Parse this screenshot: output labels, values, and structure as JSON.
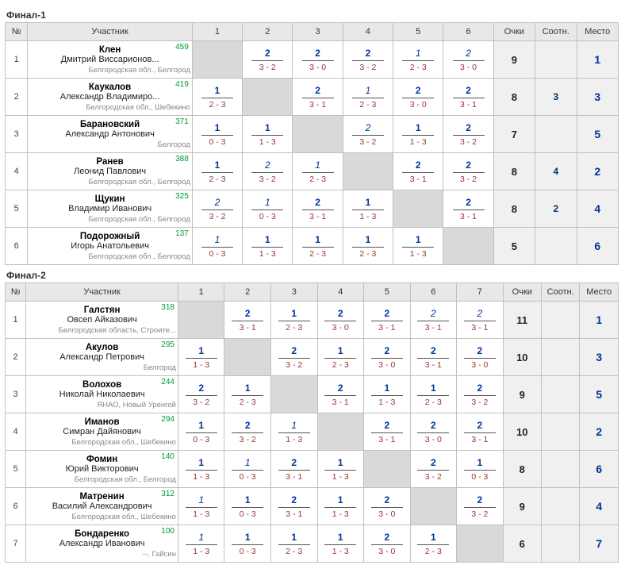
{
  "headers": {
    "num": "№",
    "participant": "Участник",
    "points": "Очки",
    "ratio": "Соотн.",
    "place": "Место"
  },
  "groups": [
    {
      "title": "Финал-1",
      "size": 6,
      "players": [
        {
          "num": 1,
          "last": "Клен",
          "first": "Дмитрий Виссарионов...",
          "rating": "459",
          "loc": "Белгородская обл., Белгород",
          "results": [
            null,
            {
              "t": "2",
              "b": "3 - 2"
            },
            {
              "t": "2",
              "b": "3 - 0"
            },
            {
              "t": "2",
              "b": "3 - 2"
            },
            {
              "t": "1",
              "i": true,
              "b": "2 - 3"
            },
            {
              "t": "2",
              "i": true,
              "b": "3 - 0"
            }
          ],
          "points": "9",
          "ratio": "",
          "place": "1"
        },
        {
          "num": 2,
          "last": "Каукалов",
          "first": "Александр Владимиро...",
          "rating": "419",
          "loc": "Белгородская обл., Шебекино",
          "results": [
            {
              "t": "1",
              "b": "2 - 3"
            },
            null,
            {
              "t": "2",
              "b": "3 - 1"
            },
            {
              "t": "1",
              "i": true,
              "b": "2 - 3"
            },
            {
              "t": "2",
              "b": "3 - 0"
            },
            {
              "t": "2",
              "b": "3 - 1"
            }
          ],
          "points": "8",
          "ratio": "3",
          "place": "3"
        },
        {
          "num": 3,
          "last": "Барановский",
          "first": "Александр Антонович",
          "rating": "371",
          "loc": "Белгород",
          "results": [
            {
              "t": "1",
              "b": "0 - 3"
            },
            {
              "t": "1",
              "b": "1 - 3"
            },
            null,
            {
              "t": "2",
              "i": true,
              "b": "3 - 2"
            },
            {
              "t": "1",
              "b": "1 - 3"
            },
            {
              "t": "2",
              "b": "3 - 2"
            }
          ],
          "points": "7",
          "ratio": "",
          "place": "5"
        },
        {
          "num": 4,
          "last": "Ранев",
          "first": "Леонид Павлович",
          "rating": "388",
          "loc": "Белгородская обл., Белгород",
          "results": [
            {
              "t": "1",
              "b": "2 - 3"
            },
            {
              "t": "2",
              "i": true,
              "b": "3 - 2"
            },
            {
              "t": "1",
              "i": true,
              "b": "2 - 3"
            },
            null,
            {
              "t": "2",
              "b": "3 - 1"
            },
            {
              "t": "2",
              "b": "3 - 2"
            }
          ],
          "points": "8",
          "ratio": "4",
          "place": "2"
        },
        {
          "num": 5,
          "last": "Щукин",
          "first": "Владимир Иванович",
          "rating": "325",
          "loc": "Белгородская обл., Белгород",
          "results": [
            {
              "t": "2",
              "i": true,
              "b": "3 - 2"
            },
            {
              "t": "1",
              "i": true,
              "b": "0 - 3"
            },
            {
              "t": "2",
              "b": "3 - 1"
            },
            {
              "t": "1",
              "b": "1 - 3"
            },
            null,
            {
              "t": "2",
              "b": "3 - 1"
            }
          ],
          "points": "8",
          "ratio": "2",
          "place": "4"
        },
        {
          "num": 6,
          "last": "Подорожный",
          "first": "Игорь Анатольевич",
          "rating": "137",
          "loc": "Белгородская обл., Белгород",
          "results": [
            {
              "t": "1",
              "i": true,
              "b": "0 - 3"
            },
            {
              "t": "1",
              "b": "1 - 3"
            },
            {
              "t": "1",
              "b": "2 - 3"
            },
            {
              "t": "1",
              "b": "2 - 3"
            },
            {
              "t": "1",
              "b": "1 - 3"
            },
            null
          ],
          "points": "5",
          "ratio": "",
          "place": "6"
        }
      ]
    },
    {
      "title": "Финал-2",
      "size": 7,
      "players": [
        {
          "num": 1,
          "last": "Галстян",
          "first": "Овсеп Айказович",
          "rating": "318",
          "loc": "Белгородская область, Строите...",
          "results": [
            null,
            {
              "t": "2",
              "b": "3 - 1"
            },
            {
              "t": "1",
              "b": "2 - 3"
            },
            {
              "t": "2",
              "b": "3 - 0"
            },
            {
              "t": "2",
              "b": "3 - 1"
            },
            {
              "t": "2",
              "i": true,
              "b": "3 - 1"
            },
            {
              "t": "2",
              "i": true,
              "b": "3 - 1"
            }
          ],
          "points": "11",
          "ratio": "",
          "place": "1"
        },
        {
          "num": 2,
          "last": "Акулов",
          "first": "Александр Петрович",
          "rating": "295",
          "loc": "Белгород",
          "results": [
            {
              "t": "1",
              "b": "1 - 3"
            },
            null,
            {
              "t": "2",
              "b": "3 - 2"
            },
            {
              "t": "1",
              "b": "2 - 3"
            },
            {
              "t": "2",
              "b": "3 - 0"
            },
            {
              "t": "2",
              "b": "3 - 1"
            },
            {
              "t": "2",
              "b": "3 - 0"
            }
          ],
          "points": "10",
          "ratio": "",
          "place": "3"
        },
        {
          "num": 3,
          "last": "Волохов",
          "first": "Николай Николаевич",
          "rating": "244",
          "loc": "ЯНАО, Новый Уренгой",
          "results": [
            {
              "t": "2",
              "b": "3 - 2"
            },
            {
              "t": "1",
              "b": "2 - 3"
            },
            null,
            {
              "t": "2",
              "b": "3 - 1"
            },
            {
              "t": "1",
              "b": "1 - 3"
            },
            {
              "t": "1",
              "b": "2 - 3"
            },
            {
              "t": "2",
              "b": "3 - 2"
            }
          ],
          "points": "9",
          "ratio": "",
          "place": "5"
        },
        {
          "num": 4,
          "last": "Иманов",
          "first": "Симран Дайянович",
          "rating": "294",
          "loc": "Белгородская обл., Шебекино",
          "results": [
            {
              "t": "1",
              "b": "0 - 3"
            },
            {
              "t": "2",
              "b": "3 - 2"
            },
            {
              "t": "1",
              "i": true,
              "b": "1 - 3"
            },
            null,
            {
              "t": "2",
              "b": "3 - 1"
            },
            {
              "t": "2",
              "b": "3 - 0"
            },
            {
              "t": "2",
              "b": "3 - 1"
            }
          ],
          "points": "10",
          "ratio": "",
          "place": "2"
        },
        {
          "num": 5,
          "last": "Фомин",
          "first": "Юрий Викторович",
          "rating": "140",
          "loc": "Белгородская обл., Белгород",
          "results": [
            {
              "t": "1",
              "b": "1 - 3"
            },
            {
              "t": "1",
              "i": true,
              "b": "0 - 3"
            },
            {
              "t": "2",
              "b": "3 - 1"
            },
            {
              "t": "1",
              "b": "1 - 3"
            },
            null,
            {
              "t": "2",
              "b": "3 - 2"
            },
            {
              "t": "1",
              "b": "0 - 3"
            }
          ],
          "points": "8",
          "ratio": "",
          "place": "6"
        },
        {
          "num": 6,
          "last": "Матренин",
          "first": "Василий Александрович",
          "rating": "312",
          "loc": "Белгородская обл., Шебекино",
          "results": [
            {
              "t": "1",
              "i": true,
              "b": "1 - 3"
            },
            {
              "t": "1",
              "b": "0 - 3"
            },
            {
              "t": "2",
              "b": "3 - 1"
            },
            {
              "t": "1",
              "b": "1 - 3"
            },
            {
              "t": "2",
              "b": "3 - 0"
            },
            null,
            {
              "t": "2",
              "b": "3 - 2"
            }
          ],
          "points": "9",
          "ratio": "",
          "place": "4"
        },
        {
          "num": 7,
          "last": "Бондаренко",
          "first": "Александр Иванович",
          "rating": "100",
          "loc": "--, Гайсин",
          "results": [
            {
              "t": "1",
              "i": true,
              "b": "1 - 3"
            },
            {
              "t": "1",
              "b": "0 - 3"
            },
            {
              "t": "1",
              "b": "2 - 3"
            },
            {
              "t": "1",
              "b": "1 - 3"
            },
            {
              "t": "2",
              "b": "3 - 0"
            },
            {
              "t": "1",
              "b": "2 - 3"
            },
            null
          ],
          "points": "6",
          "ratio": "",
          "place": "7"
        }
      ]
    }
  ]
}
